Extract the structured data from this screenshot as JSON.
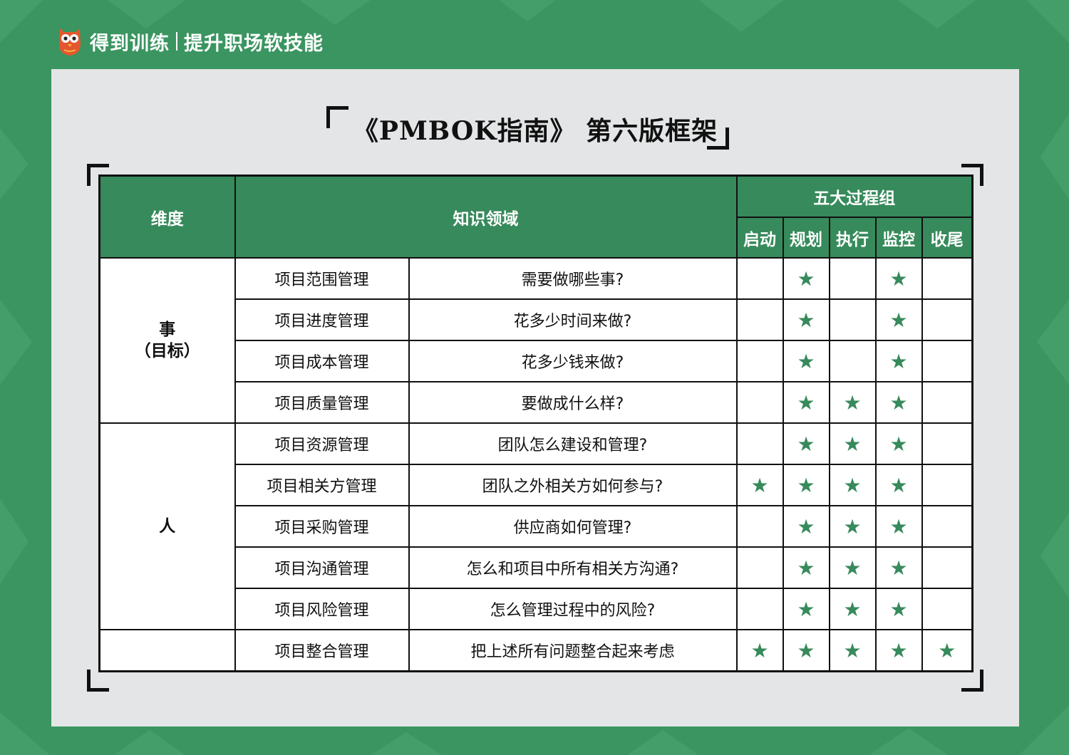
{
  "brand": {
    "name": "得到训练",
    "slogan": "提升职场软技能"
  },
  "title": "《PMBOK指南》 第六版框架",
  "headers": {
    "dimension": "维度",
    "knowledge_area": "知识领域",
    "process_group": "五大过程组",
    "processes": [
      "启动",
      "规划",
      "执行",
      "监控",
      "收尾"
    ]
  },
  "star_symbol": "★",
  "colors": {
    "accent": "#378a5b",
    "background": "#3a9560",
    "panel": "#e3e5e6"
  },
  "groups": [
    {
      "dimension_line1": "事",
      "dimension_line2": "（目标）",
      "rowspan": 4
    },
    {
      "dimension_line1": "人",
      "dimension_line2": "",
      "rowspan": 5
    },
    {
      "dimension_line1": "",
      "dimension_line2": "",
      "rowspan": 1
    }
  ],
  "rows": [
    {
      "area": "项目范围管理",
      "question": "需要做哪些事?",
      "stars": [
        false,
        true,
        false,
        true,
        false
      ]
    },
    {
      "area": "项目进度管理",
      "question": "花多少时间来做?",
      "stars": [
        false,
        true,
        false,
        true,
        false
      ]
    },
    {
      "area": "项目成本管理",
      "question": "花多少钱来做?",
      "stars": [
        false,
        true,
        false,
        true,
        false
      ]
    },
    {
      "area": "项目质量管理",
      "question": "要做成什么样?",
      "stars": [
        false,
        true,
        true,
        true,
        false
      ]
    },
    {
      "area": "项目资源管理",
      "question": "团队怎么建设和管理?",
      "stars": [
        false,
        true,
        true,
        true,
        false
      ]
    },
    {
      "area": "项目相关方管理",
      "question": "团队之外相关方如何参与?",
      "stars": [
        true,
        true,
        true,
        true,
        false
      ]
    },
    {
      "area": "项目采购管理",
      "question": "供应商如何管理?",
      "stars": [
        false,
        true,
        true,
        true,
        false
      ]
    },
    {
      "area": "项目沟通管理",
      "question": "怎么和项目中所有相关方沟通?",
      "stars": [
        false,
        true,
        true,
        true,
        false
      ]
    },
    {
      "area": "项目风险管理",
      "question": "怎么管理过程中的风险?",
      "stars": [
        false,
        true,
        true,
        true,
        false
      ]
    },
    {
      "area": "项目整合管理",
      "question": "把上述所有问题整合起来考虑",
      "stars": [
        true,
        true,
        true,
        true,
        true
      ]
    }
  ]
}
